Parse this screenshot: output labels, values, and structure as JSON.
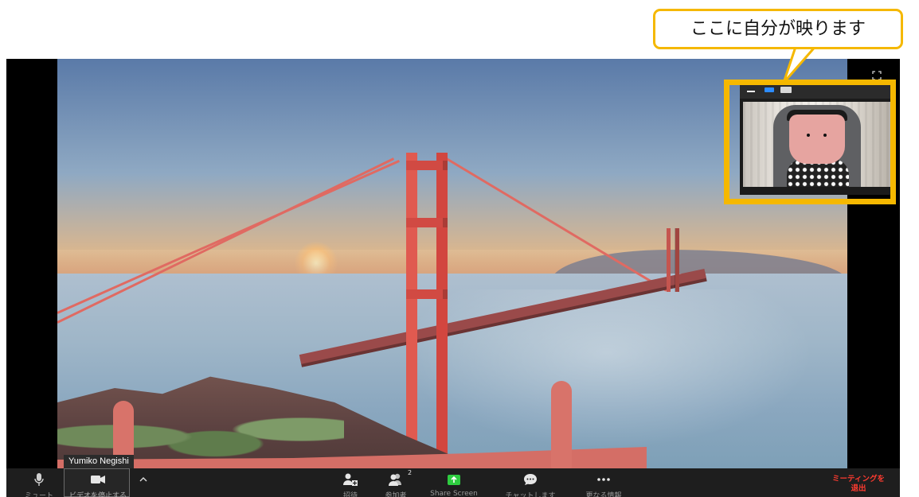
{
  "callout": {
    "text": "ここに自分が映ります",
    "accent_color": "#f5b800"
  },
  "main_video": {
    "participant_name": "Yumiko Negishi"
  },
  "self_view": {
    "controls": [
      "minimize-icon",
      "side-by-side-icon",
      "resize-icon"
    ]
  },
  "toolbar": {
    "mute_label": "ミュート",
    "video_label": "ビデオを停止する",
    "invite_label": "招待",
    "participants_label": "参加者",
    "participants_count": "2",
    "share_label": "Share Screen",
    "chat_label": "チャットします",
    "more_label": "更なる情報",
    "end_label_line1": "ミーティングを",
    "end_label_line2": "退出",
    "share_color": "#2ecc40",
    "end_color": "#ff3b30"
  }
}
